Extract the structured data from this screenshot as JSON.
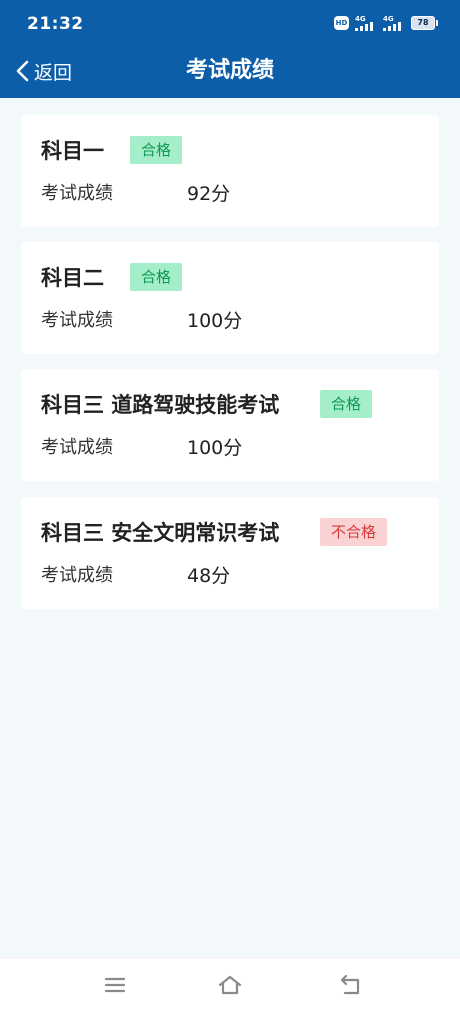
{
  "status_bar": {
    "time": "21:32",
    "hd_label": "HD",
    "signal1_label": "4G",
    "signal2_label": "4G",
    "battery_level": "78"
  },
  "header": {
    "back_label": "返回",
    "title": "考试成绩"
  },
  "results": [
    {
      "subject": "科目一",
      "status": "合格",
      "passed": true,
      "score_label": "考试成绩",
      "score": "92分"
    },
    {
      "subject": "科目二",
      "status": "合格",
      "passed": true,
      "score_label": "考试成绩",
      "score": "100分"
    },
    {
      "subject": "科目三 道路驾驶技能考试",
      "status": "合格",
      "passed": true,
      "score_label": "考试成绩",
      "score": "100分"
    },
    {
      "subject": "科目三 安全文明常识考试",
      "status": "不合格",
      "passed": false,
      "score_label": "考试成绩",
      "score": "48分"
    }
  ],
  "colors": {
    "header_bg": "#0d5ea8",
    "page_bg": "#f3f8fa",
    "pass_badge_bg": "#a6edc9",
    "pass_badge_text": "#0e9a54",
    "fail_badge_bg": "#fbd2d4",
    "fail_badge_text": "#d63b3b"
  },
  "nav_bar": {
    "icons": [
      "menu-icon",
      "home-icon",
      "back-nav-icon"
    ]
  }
}
